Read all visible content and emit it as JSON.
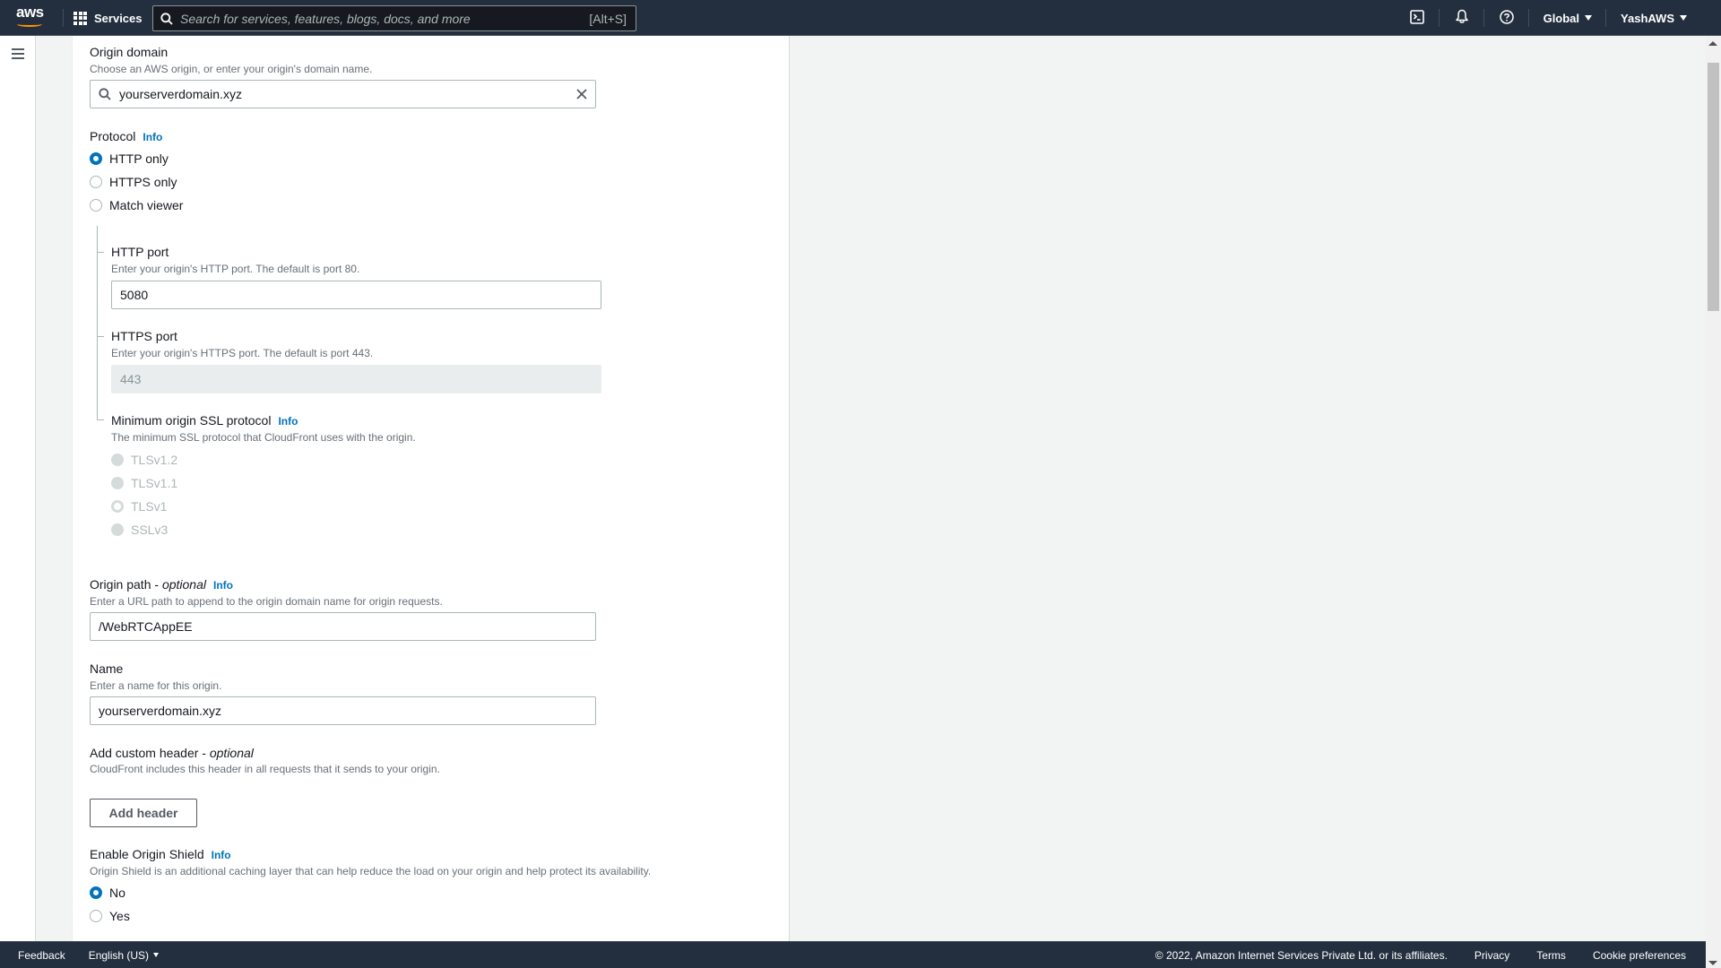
{
  "topnav": {
    "logo_text": "aws",
    "services_label": "Services",
    "search_placeholder": "Search for services, features, blogs, docs, and more",
    "search_shortcut": "[Alt+S]",
    "region_label": "Global",
    "account_label": "YashAWS",
    "icons": [
      "cloudshell-icon",
      "notifications-bell-icon",
      "help-icon"
    ]
  },
  "form": {
    "origin_domain": {
      "label": "Origin domain",
      "description": "Choose an AWS origin, or enter your origin's domain name.",
      "value": "yourserverdomain.xyz"
    },
    "protocol": {
      "label": "Protocol",
      "info": "Info",
      "options": [
        {
          "label": "HTTP only",
          "checked": true
        },
        {
          "label": "HTTPS only",
          "checked": false
        },
        {
          "label": "Match viewer",
          "checked": false
        }
      ]
    },
    "http_port": {
      "label": "HTTP port",
      "description": "Enter your origin's HTTP port. The default is port 80.",
      "value": "5080"
    },
    "https_port": {
      "label": "HTTPS port",
      "description": "Enter your origin's HTTPS port. The default is port 443.",
      "value": "443",
      "disabled": true
    },
    "min_ssl": {
      "label": "Minimum origin SSL protocol",
      "info": "Info",
      "description": "The minimum SSL protocol that CloudFront uses with the origin.",
      "options": [
        {
          "label": "TLSv1.2",
          "checked": false
        },
        {
          "label": "TLSv1.1",
          "checked": false
        },
        {
          "label": "TLSv1",
          "checked": true
        },
        {
          "label": "SSLv3",
          "checked": false
        }
      ],
      "disabled": true
    },
    "origin_path": {
      "label": "Origin path - ",
      "label_optional": "optional",
      "info": "Info",
      "description": "Enter a URL path to append to the origin domain name for origin requests.",
      "value": "/WebRTCAppEE"
    },
    "name": {
      "label": "Name",
      "description": "Enter a name for this origin.",
      "value": "yourserverdomain.xyz"
    },
    "custom_header": {
      "label": "Add custom header - ",
      "label_optional": "optional",
      "description": "CloudFront includes this header in all requests that it sends to your origin.",
      "button_label": "Add header"
    },
    "origin_shield": {
      "label": "Enable Origin Shield",
      "info": "Info",
      "description": "Origin Shield is an additional caching layer that can help reduce the load on your origin and help protect its availability.",
      "options": [
        {
          "label": "No",
          "checked": true
        },
        {
          "label": "Yes",
          "checked": false
        }
      ]
    }
  },
  "footer": {
    "feedback": "Feedback",
    "language": "English (US)",
    "copyright": "© 2022, Amazon Internet Services Private Ltd. or its affiliates.",
    "privacy": "Privacy",
    "terms": "Terms",
    "cookie_preferences": "Cookie preferences"
  },
  "colors": {
    "nav_bg": "#232f3e",
    "accent": "#0073bb",
    "brand_orange": "#ff9900",
    "page_bg": "#f2f3f3"
  }
}
